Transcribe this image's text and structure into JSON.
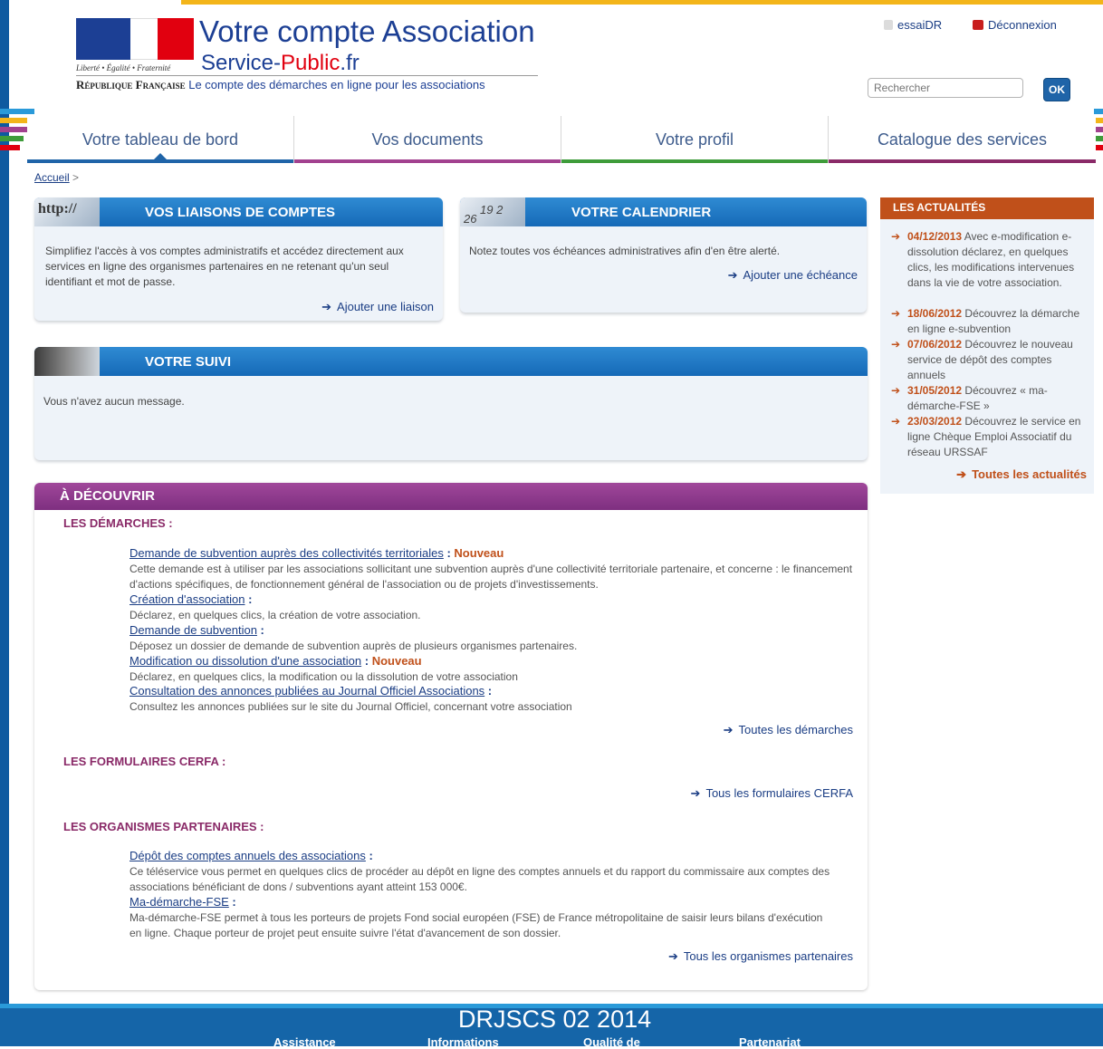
{
  "header": {
    "title": "Votre compte Association",
    "subtitle_part1": "Service-",
    "subtitle_part2": "Public",
    "subtitle_part3": ".fr",
    "motto": "Liberté • Égalité • Fraternité",
    "rf": "République Française",
    "tagline": "Le compte des démarches en ligne pour les associations",
    "user_label": "essaiDR",
    "logout_label": "Déconnexion",
    "search_placeholder": "Rechercher",
    "search_button": "OK"
  },
  "nav": {
    "tabs": [
      {
        "label": "Votre tableau de bord",
        "color": "#1f64a8"
      },
      {
        "label": "Vos documents",
        "color": "#a2418f"
      },
      {
        "label": "Votre profil",
        "color": "#3e9c3a"
      },
      {
        "label": "Catalogue des services",
        "color": "#8a2a68"
      }
    ]
  },
  "breadcrumb": {
    "home": "Accueil",
    "separator": ">"
  },
  "liaisons": {
    "title": "VOS LIAISONS DE COMPTES",
    "thumb_text": "http://",
    "text": "Simplifiez l'accès à vos comptes administratifs et accédez directement aux services en ligne des organismes partenaires en ne retenant qu'un seul identifiant et mot de passe.",
    "link": "Ajouter une liaison"
  },
  "calendrier": {
    "title": "VOTRE CALENDRIER",
    "text": "Notez toutes vos échéances administratives afin d'en être alerté.",
    "link": "Ajouter une échéance"
  },
  "suivi": {
    "title": "VOTRE SUIVI",
    "text": "Vous n'avez aucun message."
  },
  "news": {
    "title": "LES ACTUALITÉS",
    "items": [
      {
        "date": "04/12/2013",
        "text": " Avec e-modification e-dissolution déclarez, en quelques clics, les modifications intervenues dans la vie de votre association."
      },
      {
        "date": "18/06/2012",
        "text": " Découvrez la démarche en ligne e-subvention"
      },
      {
        "date": "07/06/2012",
        "text": " Découvrez le nouveau service de dépôt des comptes annuels"
      },
      {
        "date": "31/05/2012",
        "text": " Découvrez « ma-démarche-FSE »"
      },
      {
        "date": "23/03/2012",
        "text": " Découvrez le service en ligne Chèque Emploi Associatif du réseau URSSAF"
      }
    ],
    "all_link": "Toutes les actualités"
  },
  "discover": {
    "title": "À DÉCOUVRIR",
    "demarches_title": "LES DÉMARCHES :",
    "demarches": [
      {
        "link": "Demande de subvention auprès des collectivités territoriales",
        "suffix": " : ",
        "new": "Nouveau",
        "desc": "Cette demande est à utiliser par les associations sollicitant une subvention auprès d'une collectivité territoriale partenaire, et concerne : le financement d'actions spécifiques, de fonctionnement général de l'association ou de projets d'investissements."
      },
      {
        "link": "Création d'association",
        "suffix": " :",
        "new": "",
        "desc": "Déclarez, en quelques clics, la création de votre association."
      },
      {
        "link": "Demande de subvention",
        "suffix": " :",
        "new": "",
        "desc": "Déposez un dossier de demande de subvention auprès de plusieurs organismes partenaires."
      },
      {
        "link": "Modification ou dissolution d'une association",
        "suffix": " : ",
        "new": "Nouveau",
        "desc": "Déclarez, en quelques clics, la modification ou la dissolution de votre association"
      },
      {
        "link": "Consultation des annonces publiées au Journal Officiel Associations",
        "suffix": " :",
        "new": "",
        "desc": "Consultez les annonces publiées sur le site du Journal Officiel, concernant votre association"
      }
    ],
    "demarches_all": "Toutes les démarches",
    "cerfa_title": "LES FORMULAIRES CERFA :",
    "cerfa_all": "Tous les formulaires CERFA",
    "partners_title": "LES ORGANISMES PARTENAIRES :",
    "partners": [
      {
        "link": "Dépôt des comptes annuels des associations",
        "suffix": " :",
        "desc": "Ce téléservice vous permet en quelques clics de procéder au dépôt en ligne des comptes annuels et du rapport du commissaire aux comptes des associations bénéficiant de dons / subventions ayant atteint 153 000€."
      },
      {
        "link": "Ma-démarche-FSE",
        "suffix": " :",
        "desc": "Ma-démarche-FSE permet à tous les porteurs de projets Fond social européen (FSE) de France métropolitaine de saisir leurs bilans d'exécution en ligne. Chaque porteur de projet peut ensuite suivre l'état d'avancement de son dossier."
      }
    ],
    "partners_all": "Tous les organismes partenaires"
  },
  "footer": {
    "title": "DRJSCS 02 2014",
    "links": [
      "Assistance",
      "Informations",
      "Qualité de",
      "Partenariat"
    ]
  },
  "colors": {
    "blue": "#1f64a8",
    "purple": "#8a2a68",
    "orange": "#c0501a",
    "marianne_blue": "#1c3f94",
    "marianne_red": "#e1000f"
  }
}
